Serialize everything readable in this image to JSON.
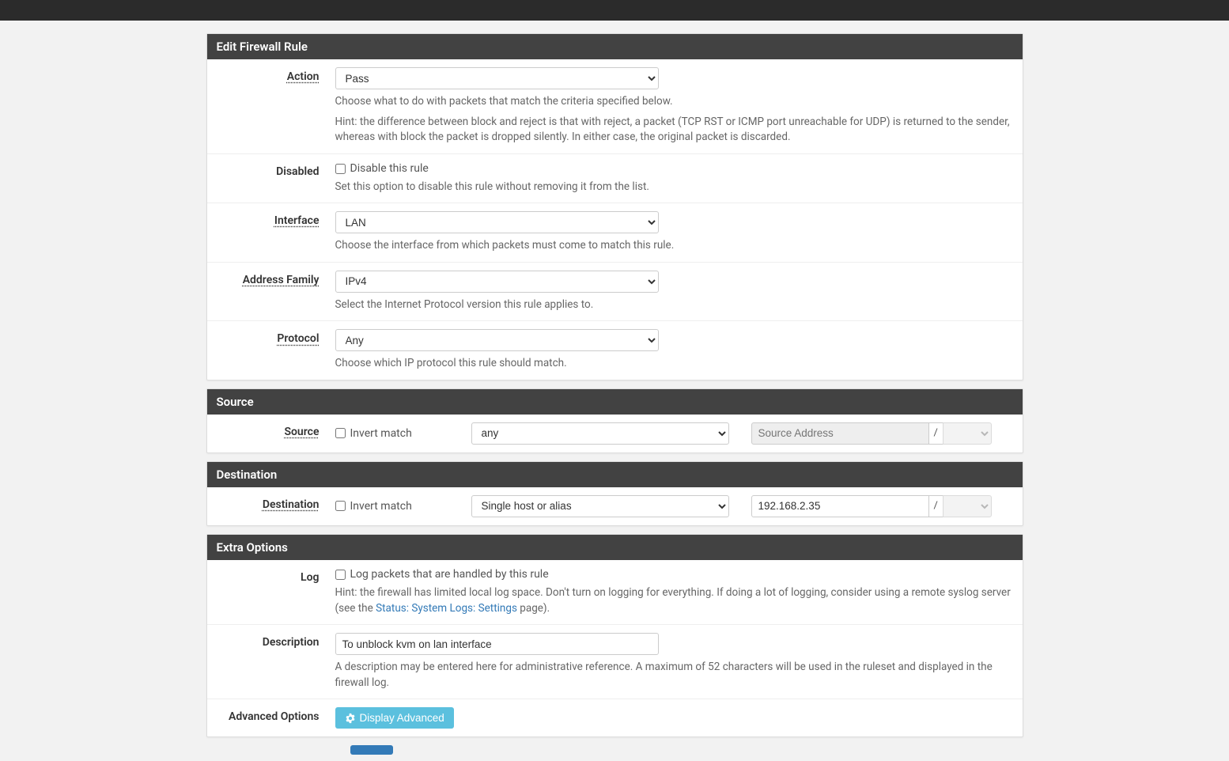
{
  "panels": {
    "edit": {
      "title": "Edit Firewall Rule",
      "action": {
        "label": "Action",
        "value": "Pass",
        "help1": "Choose what to do with packets that match the criteria specified below.",
        "help2": "Hint: the difference between block and reject is that with reject, a packet (TCP RST or ICMP port unreachable for UDP) is returned to the sender, whereas with block the packet is dropped silently. In either case, the original packet is discarded."
      },
      "disabled": {
        "label": "Disabled",
        "checkbox_label": "Disable this rule",
        "help": "Set this option to disable this rule without removing it from the list."
      },
      "interface": {
        "label": "Interface",
        "value": "LAN",
        "help": "Choose the interface from which packets must come to match this rule."
      },
      "address_family": {
        "label": "Address Family",
        "value": "IPv4",
        "help": "Select the Internet Protocol version this rule applies to."
      },
      "protocol": {
        "label": "Protocol",
        "value": "Any",
        "help": "Choose which IP protocol this rule should match."
      }
    },
    "source": {
      "title": "Source",
      "label": "Source",
      "invert_label": "Invert match",
      "type_value": "any",
      "addr_placeholder": "Source Address",
      "slash": "/",
      "mask_value": ""
    },
    "destination": {
      "title": "Destination",
      "label": "Destination",
      "invert_label": "Invert match",
      "type_value": "Single host or alias",
      "addr_value": "192.168.2.35",
      "slash": "/",
      "mask_value": ""
    },
    "extra": {
      "title": "Extra Options",
      "log": {
        "label": "Log",
        "checkbox_label": "Log packets that are handled by this rule",
        "help_pre": "Hint: the firewall has limited local log space. Don't turn on logging for everything. If doing a lot of logging, consider using a remote syslog server (see the ",
        "help_link": "Status: System Logs: Settings",
        "help_post": " page)."
      },
      "description": {
        "label": "Description",
        "value": "To unblock kvm on lan interface",
        "help": "A description may be entered here for administrative reference. A maximum of 52 characters will be used in the ruleset and displayed in the firewall log."
      },
      "advanced": {
        "label": "Advanced Options",
        "button": "Display Advanced"
      }
    }
  }
}
